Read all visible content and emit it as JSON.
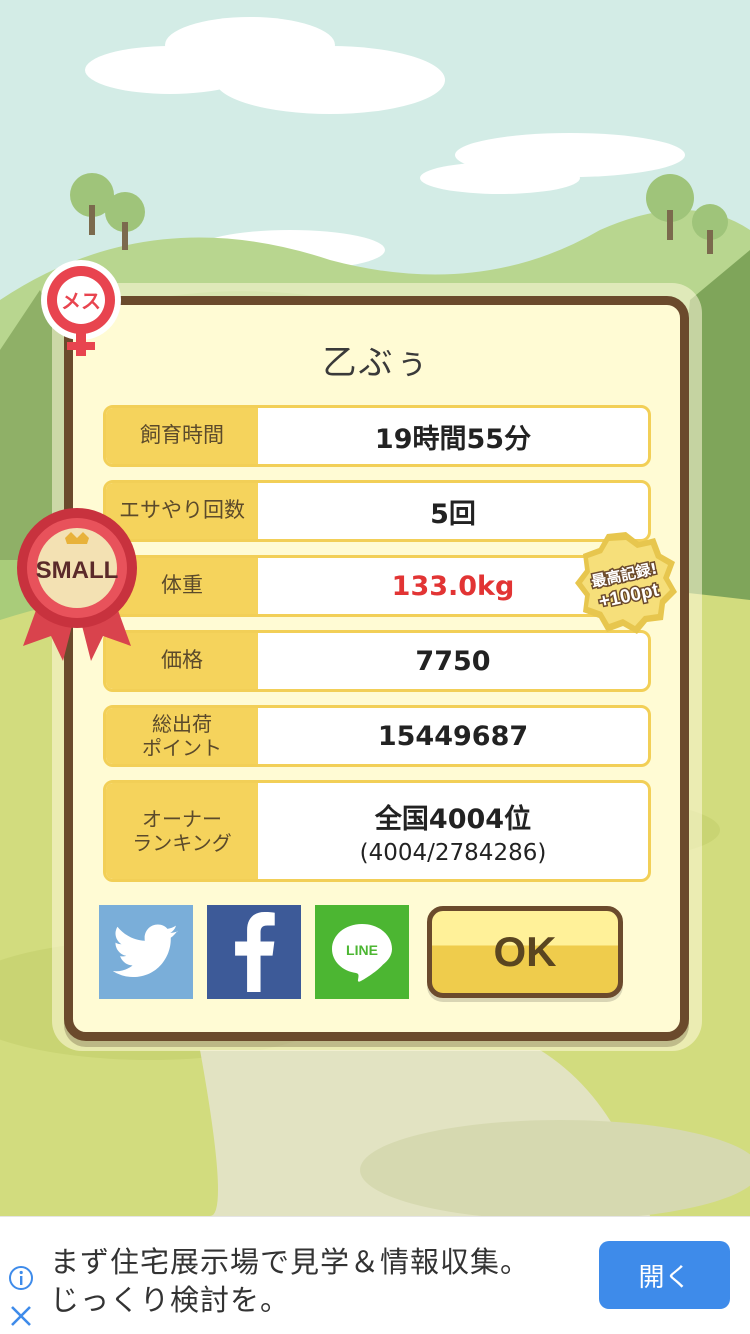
{
  "pet": {
    "name": "乙ぶぅ",
    "gender_badge": "メス",
    "size_badge": "SMALL"
  },
  "stats": [
    {
      "label": "飼育時間",
      "value": "19時間55分"
    },
    {
      "label": "エサやり回数",
      "value": "5回"
    },
    {
      "label": "体重",
      "value": "133.0kg"
    },
    {
      "label": "価格",
      "value": "7750"
    },
    {
      "label": "総出荷\nポイント",
      "value": "15449687"
    },
    {
      "label": "オーナー\nランキング",
      "value": "全国4004位",
      "sub": "(4004/2784286)"
    }
  ],
  "record_badge": {
    "line1": "最高記録!",
    "line2": "+100pt"
  },
  "buttons": {
    "twitter_icon": "twitter-bird-icon",
    "facebook_icon": "facebook-f-icon",
    "line_icon": "line-speech-icon",
    "line_label": "LINE",
    "ok_label": "OK"
  },
  "ad": {
    "line1": "まず住宅展示場で見学＆情報収集。",
    "line2": "じっくり検討を。",
    "open_label": "開く"
  },
  "colors": {
    "panel_border": "#6b4a2c",
    "label_bg": "#f5d35c",
    "highlight_value": "#e23434",
    "ad_button": "#3e8bea"
  }
}
